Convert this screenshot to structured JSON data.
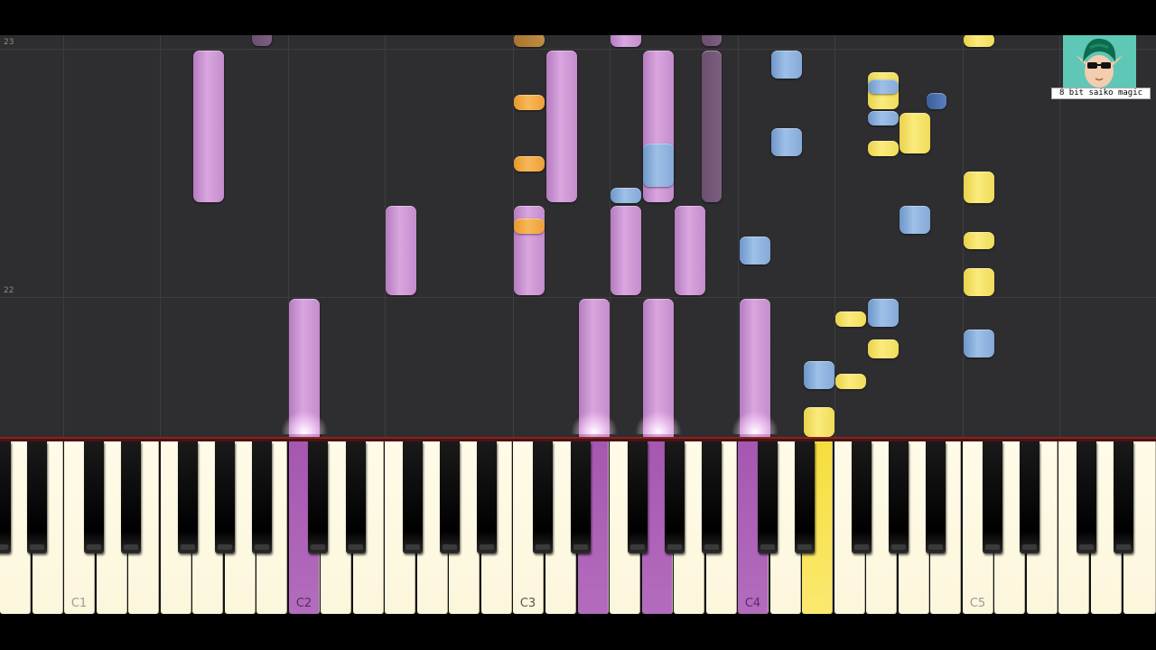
{
  "roll": {
    "measure_labels": [
      "23",
      "22"
    ]
  },
  "keyboard": {
    "octave_labels": [
      "C1",
      "C2",
      "C3",
      "C4",
      "C5"
    ]
  },
  "channel": {
    "caption": "8 bit saiko magic",
    "avatar_icon": "elf-avatar-icon"
  },
  "colors": {
    "purple": "#c48ccc",
    "blue": "#85a9d8",
    "yellow": "#f0dc5a",
    "orange": "#ee9f37",
    "background": "#2e2e30"
  }
}
